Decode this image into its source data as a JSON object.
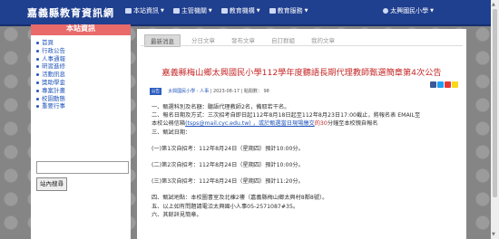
{
  "site": {
    "title": "嘉義縣教育資訊網"
  },
  "nav": {
    "items": [
      {
        "label": "本站資訊"
      },
      {
        "label": "主管機關"
      },
      {
        "label": "教育機構"
      },
      {
        "label": "教育服務"
      }
    ],
    "user": "太興國民小學"
  },
  "sidebar": {
    "header": "本站資訊",
    "items": [
      "首頁",
      "行政公告",
      "人事通報",
      "研習進修",
      "活動訊息",
      "獎助學金",
      "專案計畫",
      "校園動態",
      "重要行事"
    ],
    "search_button": "站內搜尋"
  },
  "tabs": [
    "最新消息",
    "分日文章",
    "發布文章",
    "自訂群組",
    "我的文章"
  ],
  "article": {
    "title": "嘉義縣梅山鄉太興國民小學112學年度聽語長期代理教師甄選簡章第4次公告",
    "badge": "公告",
    "author": "太興國民小學 - 人事",
    "date": "| 2023-08-17 | 點閱數：",
    "views": "98",
    "lines": [
      "一、甄選科別及名額：聽語代理教師2名，備取若干名。",
      "二、報名日期及方式：三次招考自即日起112年8月18日起至112年8月23日17:00截止，將報名表 EMAIL至",
      "本校公務信箱",
      "三、甄試日期：",
      "(一)第1次自招考：112年8月24日（星期四）預計10:00分。",
      "(二)第2次自招考：112年8月24日（星期四）預計10:00分。",
      "(三)第3次自招考：112年8月24日（星期四）預計11:20分。",
      "四、甄試地點：本校圖書室及北棟2樓（嘉義縣梅山鄉太興村8鄰8號）。",
      "五、以上如有問題請電洽太興國小人事05-2571087#35。",
      "六、其餘詳見簡章。"
    ],
    "email_link": "(tsps@mail.cyc.edu.tw) ，或於甄選當日現場繳交",
    "email_note": "的30",
    "email_tail": "分鐘至本校親自報名"
  }
}
